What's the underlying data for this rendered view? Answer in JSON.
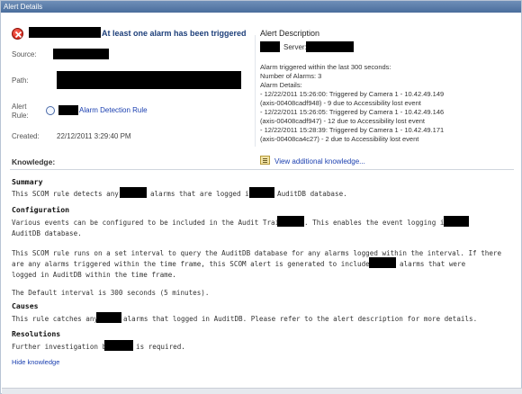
{
  "window": {
    "title": "Alert Details"
  },
  "alert": {
    "headline": "At least one alarm has been triggered",
    "source_label": "Source:",
    "path_label": "Path:",
    "rule_label_1": "Alert",
    "rule_label_2": "Rule:",
    "rule_link": "Alarm Detection Rule",
    "created_label": "Created:",
    "created_value": "22/12/2011 3:29:40 PM"
  },
  "description": {
    "heading": "Alert Description",
    "server_label": "Server:",
    "lines": [
      "Alarm triggered within the last 300 seconds:",
      "Number of Alarms: 3",
      "Alarm Details:",
      "-    12/22/2011 15:26:00: Triggered by Camera 1 - 10.42.49.149",
      "(axis-00408cadf948) - 9 due to Accessibility lost event",
      "-    12/22/2011 15:26:05: Triggered by Camera 1 - 10.42.49.146",
      "(axis-00408cadf947) - 12 due to Accessibility lost event",
      "-    12/22/2011 15:28:39: Triggered by Camera 1 - 10.42.49.171",
      "(axis-00408ca4c27) - 2 due to Accessibility lost event"
    ]
  },
  "knowledge": {
    "heading": "Knowledge:",
    "view_link": "View additional knowledge...",
    "summary_heading": "Summary",
    "summary_a": "This SCOM rule detects any",
    "summary_b": "alarms that are logged in",
    "summary_c": "AuditDB database.",
    "config_heading": "Configuration",
    "config_a": "Various events can be configured to be included in the Audit Trail in",
    "config_b": ". This enables the event logging into",
    "config_c": "AuditDB database.",
    "para_1": "This SCOM rule runs on a set interval to query the AuditDB database for any alarms logged within the interval. If there",
    "para_2a": "are any alarms triggered within the time frame, this SCOM alert is generated to include ALL",
    "para_2b": "alarms that were",
    "para_3": "logged in AuditDB within the time frame.",
    "default_interval": "The Default interval is 300 seconds (5 minutes).",
    "causes_heading": "Causes",
    "causes_a": "This rule catches any",
    "causes_b": "alarms that logged in AuditDB. Please refer to the alert description for more details.",
    "resolutions_heading": "Resolutions",
    "resolutions_a": "Further investigation by",
    "resolutions_b": "is required.",
    "hide_link": "Hide knowledge"
  }
}
